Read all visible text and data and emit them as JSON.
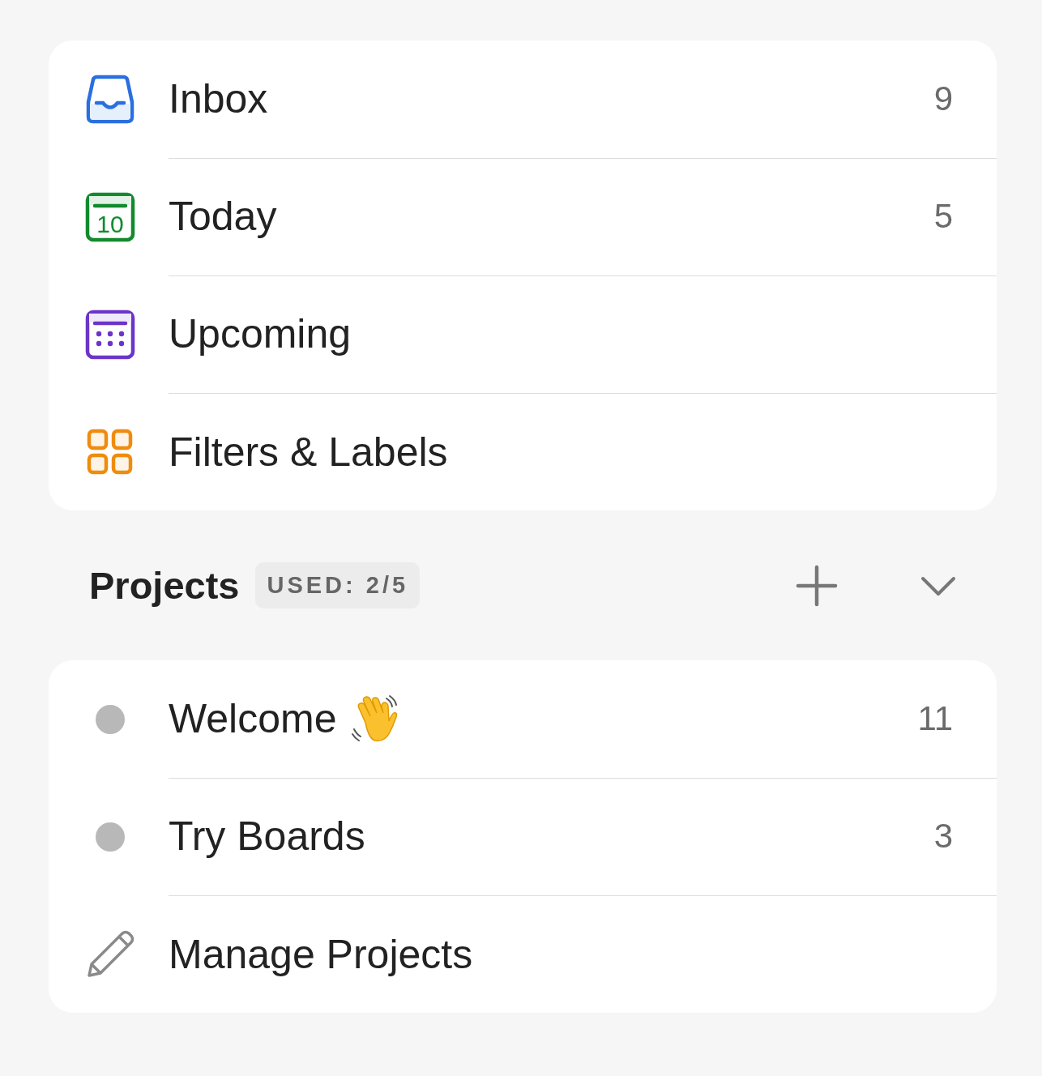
{
  "nav_items": [
    {
      "kind": "inbox",
      "label": "Inbox",
      "count": "9"
    },
    {
      "kind": "today",
      "label": "Today",
      "count": "5",
      "day": "10"
    },
    {
      "kind": "upcoming",
      "label": "Upcoming"
    },
    {
      "kind": "filters",
      "label": "Filters & Labels"
    }
  ],
  "projects": {
    "title": "Projects",
    "usage": "USED: 2/5",
    "expanded": true,
    "items": [
      {
        "kind": "project",
        "label": "Welcome",
        "waving": true,
        "count": "11",
        "color": "#b8b8b8"
      },
      {
        "kind": "project",
        "label": "Try Boards",
        "count": "3",
        "color": "#b8b8b8"
      },
      {
        "kind": "manage",
        "label": "Manage Projects"
      }
    ]
  }
}
